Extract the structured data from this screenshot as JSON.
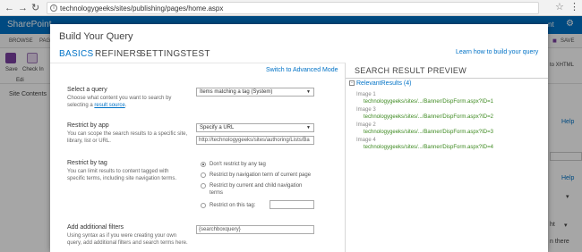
{
  "browser": {
    "url": "technologygeeks/sites/publishing/pages/home.aspx",
    "back_icon": "arrow-left-icon",
    "forward_icon": "arrow-right-icon",
    "reload_icon": "reload-icon"
  },
  "sharepoint": {
    "title": "SharePoint",
    "nt_label": "nt",
    "ribbon_tabs": [
      "BROWSE",
      "PAG"
    ],
    "save_top": "SAVE",
    "save_label": "Save",
    "checkin_label": "Check In",
    "edit_label": "Edi",
    "site_contents": "Site Contents",
    "help_1": "Help",
    "help_2": "Help",
    "xhtml": "to XHTML",
    "edge_ht": "ht",
    "edge_there": "n there"
  },
  "dialog": {
    "title": "Build Your Query",
    "tabs": [
      "BASICS",
      "REFINERS",
      "SETTINGS",
      "TEST"
    ],
    "learn_link": "Learn how to build your query",
    "advanced_link": "Switch to Advanced Mode",
    "select_query": {
      "title": "Select a query",
      "desc_prefix": "Choose what content you want to search by selecting a ",
      "desc_link": "result source",
      "desc_suffix": ".",
      "value": "Items matching a tag (System)"
    },
    "restrict_app": {
      "title": "Restrict by app",
      "desc": "You can scope the search results to a specific site, library, list or URL.",
      "value": "Specify a URL",
      "url_value": "http://technologygeeks/sites/authoring/Lists/Ba"
    },
    "restrict_tag": {
      "title": "Restrict by tag",
      "desc": "You can limit results to content tagged with specific terms, including site navigation terms.",
      "options": [
        "Don't restrict by any tag",
        "Restrict by navigation term of current page",
        "Restrict by current and child navigation terms",
        "Restrict on this tag:"
      ],
      "checked_index": 0,
      "tag_value": ""
    },
    "filters": {
      "title": "Add additional filters",
      "desc": "Using syntax as if you were creating your own query, add additional filters and search terms here.",
      "value": "{searchboxquery}"
    }
  },
  "preview": {
    "title": "SEARCH RESULT PREVIEW",
    "group_label": "RelevantResults (4)",
    "toggle": "-",
    "results": [
      {
        "title": "Image 1",
        "url": "technologygeeks/sites/.../Banner/DispForm.aspx?ID=1"
      },
      {
        "title": "Image 3",
        "url": "technologygeeks/sites/.../Banner/DispForm.aspx?ID=2"
      },
      {
        "title": "Image 2",
        "url": "technologygeeks/sites/.../Banner/DispForm.aspx?ID=3"
      },
      {
        "title": "Image 4",
        "url": "technologygeeks/sites/.../Banner/DispForm.aspx?ID=4"
      }
    ]
  }
}
